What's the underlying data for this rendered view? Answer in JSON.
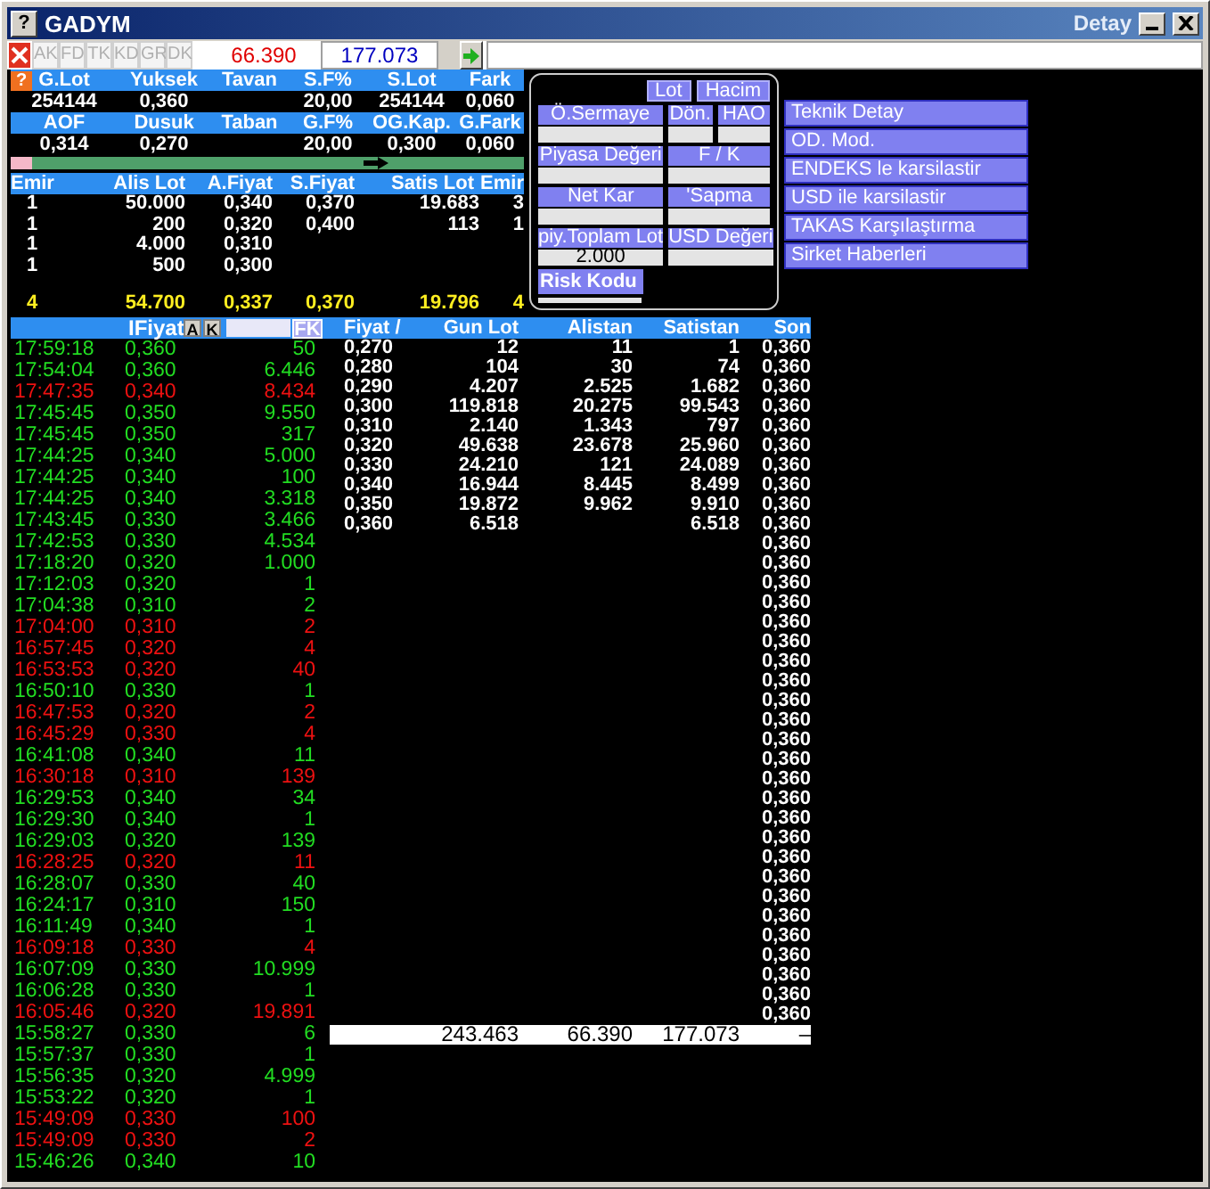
{
  "window": {
    "title": "GADYM",
    "help_glyph": "?",
    "caption_right": "Detay"
  },
  "toolbar": {
    "tabs": [
      {
        "label": "AK",
        "disabled": true
      },
      {
        "label": "FD",
        "disabled": true
      },
      {
        "label": "TK",
        "disabled": true
      },
      {
        "label": "KD",
        "disabled": true
      },
      {
        "label": "GR",
        "disabled": true
      },
      {
        "label": "DK",
        "disabled": true
      }
    ],
    "value_red": "66.390",
    "value_blue": "177.073"
  },
  "summary": {
    "help_glyph": "?",
    "blocks": [
      [
        {
          "header": "G.Lot",
          "value": "254144"
        },
        {
          "header": "Yuksek",
          "value": "0,360"
        },
        {
          "header": "Tavan"
        },
        {
          "header": "S.F%",
          "value": "20,00"
        },
        {
          "header": "S.Lot",
          "value": "254144"
        },
        {
          "header": "Fark",
          "value": "0,060"
        }
      ],
      [
        {
          "header": "AOF",
          "value": "0,314"
        },
        {
          "header": "Dusuk",
          "value": "0,270"
        },
        {
          "header": "Taban"
        },
        {
          "header": "G.F%",
          "value": "20,00"
        },
        {
          "header": "OG.Kap.",
          "value": "0,300"
        },
        {
          "header": "G.Fark",
          "value": "0,060"
        }
      ]
    ]
  },
  "balance_bar": {
    "level": 0.04
  },
  "depth": {
    "columns": [
      "Emir",
      "Alis Lot",
      "A.Fiyat",
      "S.Fiyat",
      "Satis Lot",
      "Emir"
    ],
    "rows": [
      {
        "emir_buy": "1",
        "alis_lot": "50.000",
        "a_fiyat": "0,340",
        "s_fiyat": "0,370",
        "satis_lot": "19.683",
        "emir_sell": "3"
      },
      {
        "emir_buy": "1",
        "alis_lot": "200",
        "a_fiyat": "0,320",
        "s_fiyat": "0,400",
        "satis_lot": "113",
        "emir_sell": "1"
      },
      {
        "emir_buy": "1",
        "alis_lot": "4.000",
        "a_fiyat": "0,310"
      },
      {
        "emir_buy": "1",
        "alis_lot": "500",
        "a_fiyat": "0,300"
      }
    ],
    "totals": {
      "emir_buy": "4",
      "alis_lot": "54.700",
      "a_fiyat": "0,337",
      "s_fiyat": "0,370",
      "satis_lot": "19.796",
      "emir_sell": "4"
    }
  },
  "info_panel": {
    "toggles": [
      "Lot",
      "Hacim"
    ],
    "field_rows": [
      [
        {
          "label": "Ö.Sermaye"
        },
        {
          "label": "Dön."
        },
        {
          "label": "HAO"
        }
      ],
      [
        {
          "label": "Piyasa Değeri"
        },
        {
          "label": "F / K"
        }
      ],
      [
        {
          "label": "Net Kar"
        },
        {
          "label": "'Sapma"
        }
      ],
      [
        {
          "label": "piy.Toplam Lot",
          "value": "2.000"
        },
        {
          "label": "USD Değeri"
        }
      ]
    ],
    "risk_label": "Risk Kodu"
  },
  "menu": [
    "Teknik Detay",
    "OD. Mod.",
    "ENDEKS le karsilastir",
    "USD ile karsilastir",
    "TAKAS Karşılaştırma",
    "Sirket Haberleri"
  ],
  "trades": {
    "header": "IFiyat",
    "buttons": [
      "A",
      "K"
    ],
    "filter_button": "FK",
    "rows": [
      {
        "time": "17:59:18",
        "price": "0,360",
        "lot": "50",
        "color": "#22dd22"
      },
      {
        "time": "17:54:04",
        "price": "0,360",
        "lot": "6.446",
        "color": "#22dd22"
      },
      {
        "time": "17:47:35",
        "price": "0,340",
        "lot": "8.434",
        "color": "#ee1111"
      },
      {
        "time": "17:45:45",
        "price": "0,350",
        "lot": "9.550",
        "color": "#22dd22"
      },
      {
        "time": "17:45:45",
        "price": "0,350",
        "lot": "317",
        "color": "#22dd22"
      },
      {
        "time": "17:44:25",
        "price": "0,340",
        "lot": "5.000",
        "color": "#22dd22"
      },
      {
        "time": "17:44:25",
        "price": "0,340",
        "lot": "100",
        "color": "#22dd22"
      },
      {
        "time": "17:44:25",
        "price": "0,340",
        "lot": "3.318",
        "color": "#22dd22"
      },
      {
        "time": "17:43:45",
        "price": "0,330",
        "lot": "3.466",
        "color": "#22dd22"
      },
      {
        "time": "17:42:53",
        "price": "0,330",
        "lot": "4.534",
        "color": "#22dd22"
      },
      {
        "time": "17:18:20",
        "price": "0,320",
        "lot": "1.000",
        "color": "#22dd22"
      },
      {
        "time": "17:12:03",
        "price": "0,320",
        "lot": "1",
        "color": "#22dd22"
      },
      {
        "time": "17:04:38",
        "price": "0,310",
        "lot": "2",
        "color": "#22dd22"
      },
      {
        "time": "17:04:00",
        "price": "0,310",
        "lot": "2",
        "color": "#ee1111"
      },
      {
        "time": "16:57:45",
        "price": "0,320",
        "lot": "4",
        "color": "#ee1111"
      },
      {
        "time": "16:53:53",
        "price": "0,320",
        "lot": "40",
        "color": "#ee1111"
      },
      {
        "time": "16:50:10",
        "price": "0,330",
        "lot": "1",
        "color": "#22dd22"
      },
      {
        "time": "16:47:53",
        "price": "0,320",
        "lot": "2",
        "color": "#ee1111"
      },
      {
        "time": "16:45:29",
        "price": "0,330",
        "lot": "4",
        "color": "#ee1111"
      },
      {
        "time": "16:41:08",
        "price": "0,340",
        "lot": "11",
        "color": "#22dd22"
      },
      {
        "time": "16:30:18",
        "price": "0,310",
        "lot": "139",
        "color": "#ee1111"
      },
      {
        "time": "16:29:53",
        "price": "0,340",
        "lot": "34",
        "color": "#22dd22"
      },
      {
        "time": "16:29:30",
        "price": "0,340",
        "lot": "1",
        "color": "#22dd22"
      },
      {
        "time": "16:29:03",
        "price": "0,320",
        "lot": "139",
        "color": "#22dd22"
      },
      {
        "time": "16:28:25",
        "price": "0,320",
        "lot": "11",
        "color": "#ee1111"
      },
      {
        "time": "16:28:07",
        "price": "0,330",
        "lot": "40",
        "color": "#22dd22"
      },
      {
        "time": "16:24:17",
        "price": "0,310",
        "lot": "150",
        "color": "#22dd22"
      },
      {
        "time": "16:11:49",
        "price": "0,340",
        "lot": "1",
        "color": "#22dd22"
      },
      {
        "time": "16:09:18",
        "price": "0,330",
        "lot": "4",
        "color": "#ee1111"
      },
      {
        "time": "16:07:09",
        "price": "0,330",
        "lot": "10.999",
        "color": "#22dd22"
      },
      {
        "time": "16:06:28",
        "price": "0,330",
        "lot": "1",
        "color": "#22dd22"
      },
      {
        "time": "16:05:46",
        "price": "0,320",
        "lot": "19.891",
        "color": "#ee1111"
      },
      {
        "time": "15:58:27",
        "price": "0,330",
        "lot": "6",
        "color": "#22dd22"
      },
      {
        "time": "15:57:37",
        "price": "0,330",
        "lot": "1",
        "color": "#22dd22"
      },
      {
        "time": "15:56:35",
        "price": "0,320",
        "lot": "4.999",
        "color": "#22dd22"
      },
      {
        "time": "15:53:22",
        "price": "0,320",
        "lot": "1",
        "color": "#22dd22"
      },
      {
        "time": "15:49:09",
        "price": "0,330",
        "lot": "100",
        "color": "#ee1111"
      },
      {
        "time": "15:49:09",
        "price": "0,330",
        "lot": "2",
        "color": "#ee1111"
      },
      {
        "time": "15:46:26",
        "price": "0,340",
        "lot": "10",
        "color": "#22dd22"
      }
    ]
  },
  "price_table": {
    "columns": [
      "Fiyat /",
      "Gun Lot",
      "Alistan",
      "Satistan",
      "Son"
    ],
    "rows": [
      {
        "fiyat": "0,270",
        "gun_lot": "12",
        "alistan": "11",
        "satistan": "1",
        "son": "0,360"
      },
      {
        "fiyat": "0,280",
        "gun_lot": "104",
        "alistan": "30",
        "satistan": "74",
        "son": "0,360"
      },
      {
        "fiyat": "0,290",
        "gun_lot": "4.207",
        "alistan": "2.525",
        "satistan": "1.682",
        "son": "0,360"
      },
      {
        "fiyat": "0,300",
        "gun_lot": "119.818",
        "alistan": "20.275",
        "satistan": "99.543",
        "son": "0,360"
      },
      {
        "fiyat": "0,310",
        "gun_lot": "2.140",
        "alistan": "1.343",
        "satistan": "797",
        "son": "0,360"
      },
      {
        "fiyat": "0,320",
        "gun_lot": "49.638",
        "alistan": "23.678",
        "satistan": "25.960",
        "son": "0,360"
      },
      {
        "fiyat": "0,330",
        "gun_lot": "24.210",
        "alistan": "121",
        "satistan": "24.089",
        "son": "0,360"
      },
      {
        "fiyat": "0,340",
        "gun_lot": "16.944",
        "alistan": "8.445",
        "satistan": "8.499",
        "son": "0,360"
      },
      {
        "fiyat": "0,350",
        "gun_lot": "19.872",
        "alistan": "9.962",
        "satistan": "9.910",
        "son": "0,360"
      },
      {
        "fiyat": "0,360",
        "gun_lot": "6.518",
        "satistan": "6.518",
        "son": "0,360"
      },
      {
        "son": "0,360"
      },
      {
        "son": "0,360"
      },
      {
        "son": "0,360"
      },
      {
        "son": "0,360"
      },
      {
        "son": "0,360"
      },
      {
        "son": "0,360"
      },
      {
        "son": "0,360"
      },
      {
        "son": "0,360"
      },
      {
        "son": "0,360"
      },
      {
        "son": "0,360"
      },
      {
        "son": "0,360"
      },
      {
        "son": "0,360"
      },
      {
        "son": "0,360"
      },
      {
        "son": "0,360"
      },
      {
        "son": "0,360"
      },
      {
        "son": "0,360"
      },
      {
        "son": "0,360"
      },
      {
        "son": "0,360"
      },
      {
        "son": "0,360"
      },
      {
        "son": "0,360"
      },
      {
        "son": "0,360"
      },
      {
        "son": "0,360"
      },
      {
        "son": "0,360"
      },
      {
        "son": "0,360"
      },
      {
        "son": "0,360"
      }
    ],
    "totals": {
      "gun_lot": "243.463",
      "alistan": "66.390",
      "satistan": "177.073",
      "son": "–"
    }
  }
}
